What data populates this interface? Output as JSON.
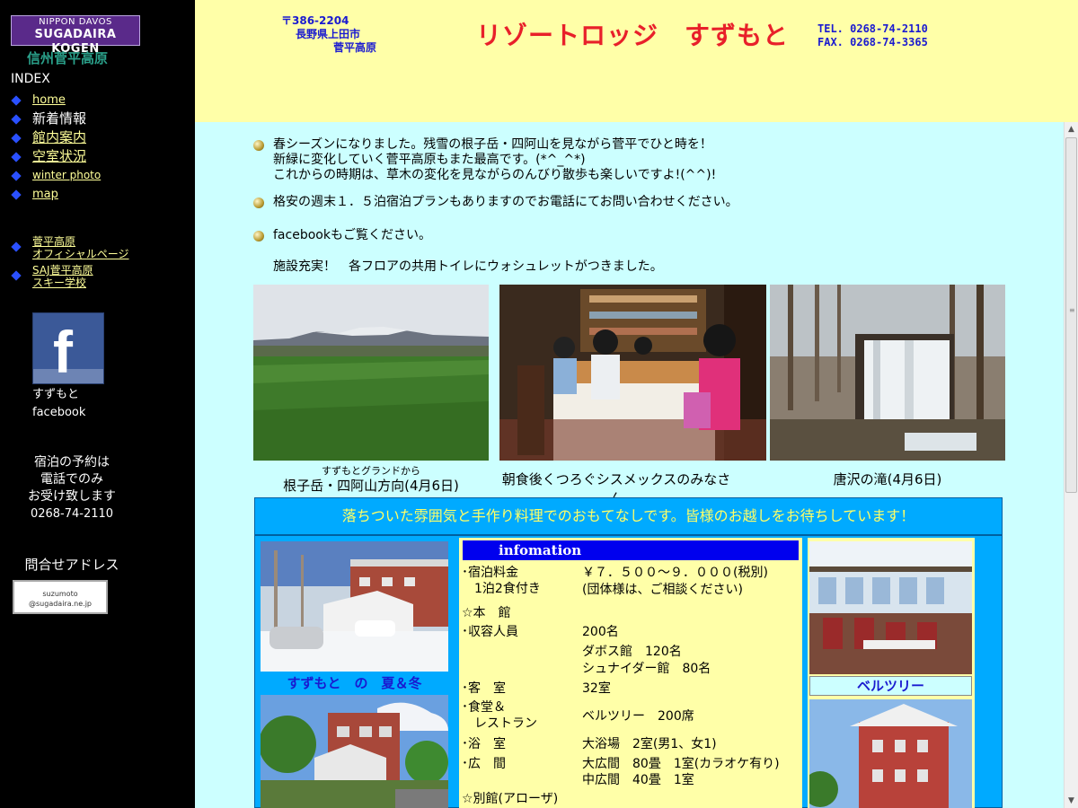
{
  "sidebar": {
    "logo_line1": "NIPPON DAVOS",
    "logo_line2": "SUGADAIRA KOGEN",
    "subtitle": "信州菅平高原",
    "index_heading": "INDEX",
    "nav_items": [
      "home",
      "新着情報",
      "館内案内",
      "空室状況",
      "winter photo",
      "map"
    ],
    "ext_links": [
      {
        "line1": "菅平高原",
        "line2": "オフィシャルページ"
      },
      {
        "line1": "SAJ菅平高原",
        "line2": "スキー学校"
      }
    ],
    "facebook_line1": "すずもと",
    "facebook_line2": "facebook",
    "reservation": [
      "宿泊の予約は",
      "電話でのみ",
      "お受け致します",
      "0268-74-2110"
    ],
    "contact_heading": "問合せアドレス",
    "contact_badge_line1": "suzumoto",
    "contact_badge_line2": "@sugadaira.ne.jp"
  },
  "header": {
    "postal": "〒386-2204",
    "address1": "長野県上田市",
    "address2": "菅平高原",
    "hotel_name": "リゾートロッジ　すずもと",
    "tel": "TEL. 0268-74-2110",
    "fax": "FAX. 0268-74-3365"
  },
  "news": [
    {
      "lines": [
        "春シーズンになりました。残雪の根子岳・四阿山を見ながら菅平でひと時を！",
        "新緑に変化していく菅平高原もまた最高です。(*^_^*)",
        "これからの時期は、草木の変化を見ながらのんびり散歩も楽しいですよ!(^^)!"
      ]
    },
    {
      "lines": [
        "格安の週末１．５泊宿泊プランもありますのでお電話にてお問い合わせください。"
      ]
    },
    {
      "lines": [
        "facebookもご覧ください。"
      ]
    }
  ],
  "facility_note": "施設充実！　各フロアの共用トイレにウォシュレットがつきました。",
  "photos": [
    {
      "caption_small": "すずもとグランドから",
      "caption": "根子岳・四阿山方向(4月6日)"
    },
    {
      "caption": "朝食後くつろぐシスメックスのみなさん"
    },
    {
      "caption": "唐沢の滝(4月6日)"
    }
  ],
  "banner": "落ちついた雰囲気と手作り料理でのおもてなしです。皆様のお越しをお待ちしています！",
  "season_caption": "すずもと　の　夏＆冬",
  "info": {
    "heading": "infomation",
    "rows": [
      {
        "label": "･宿泊料金",
        "value": "￥７．５００～９．０００(税別)"
      },
      {
        "label": "　1泊2食付き",
        "value": "(団体様は、ご相談ください)"
      },
      {
        "label": "☆本　館",
        "value": ""
      },
      {
        "label": "･収容人員",
        "value": "200名"
      },
      {
        "label": "",
        "value": "ダボス館　120名"
      },
      {
        "label": "",
        "value": "シュナイダー館　80名"
      },
      {
        "label": "･客　室",
        "value": "32室"
      },
      {
        "label": "･食堂＆",
        "value": ""
      },
      {
        "label": "　レストラン",
        "value": "ベルツリー　200席"
      },
      {
        "label": "･浴　室",
        "value": "大浴場　2室(男1、女1)"
      },
      {
        "label": "･広　間",
        "value": "大広間　80畳　1室(カラオケ有り)"
      },
      {
        "label": "",
        "value": "中広間　40畳　1室"
      },
      {
        "label": "☆別館(アローザ)",
        "value": ""
      }
    ]
  },
  "bell_caption": "ベルツリー",
  "colors": {
    "header_bg": "#ffffa8",
    "main_bg": "#ccffff",
    "banner_bg": "#00aaff",
    "hotel_name": "#e8202a",
    "nav_link": "#ffff99"
  }
}
